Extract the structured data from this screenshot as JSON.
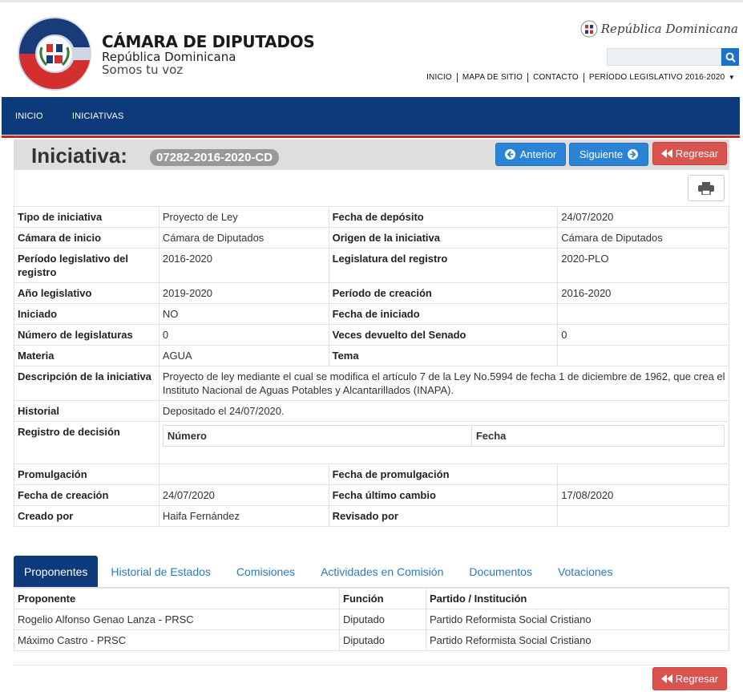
{
  "header": {
    "brand_title": "CÁMARA DE DIPUTADOS",
    "brand_sub": "República Dominicana",
    "brand_slogan": "Somos tu voz",
    "republica": "República Dominicana",
    "search_placeholder": "",
    "top_links": [
      "INICIO",
      "MAPA DE SITIO",
      "CONTACTO",
      "PERÍODO LEGISLATIVO 2016-2020"
    ]
  },
  "nav": {
    "items": [
      "INICIO",
      "INICIATIVAS"
    ]
  },
  "title": {
    "label": "Iniciativa:",
    "code": "07282-2016-2020-CD",
    "prev": "Anterior",
    "next": "Siguiente",
    "back": "Regresar"
  },
  "info": {
    "tipo_k": "Tipo de iniciativa",
    "tipo_v": "Proyecto de Ley",
    "fdep_k": "Fecha de depósito",
    "fdep_v": "24/07/2020",
    "cam_k": "Cámara de inicio",
    "cam_v": "Cámara de Diputados",
    "orig_k": "Origen de la iniciativa",
    "orig_v": "Cámara de Diputados",
    "per_k": "Período legislativo del registro",
    "per_v": "2016-2020",
    "legreg_k": "Legislatura del registro",
    "legreg_v": "2020-PLO",
    "anio_k": "Año legislativo",
    "anio_v": "2019-2020",
    "percre_k": "Período de creación",
    "percre_v": "2016-2020",
    "inic_k": "Iniciado",
    "inic_v": "NO",
    "finic_k": "Fecha de iniciado",
    "finic_v": "",
    "numleg_k": "Número de legislaturas",
    "numleg_v": "0",
    "veces_k": "Veces devuelto del Senado",
    "veces_v": "0",
    "mat_k": "Materia",
    "mat_v": "AGUA",
    "tema_k": "Tema",
    "tema_v": "",
    "desc_k": "Descripción de la iniciativa",
    "desc_v": "Proyecto de ley mediante el cual se modifica el artículo 7 de la Ley No.5994 de fecha 1 de diciembre de 1962, que crea el Instituto Nacional de Aguas Potables y Alcantarillados (INAPA).",
    "hist_k": "Historial",
    "hist_v": "Depositado el 24/07/2020.",
    "regdec_k": "Registro de decisión",
    "regdec_num": "Número",
    "regdec_fecha": "Fecha",
    "prom_k": "Promulgación",
    "prom_v": "",
    "fprom_k": "Fecha de promulgación",
    "fprom_v": "",
    "fcre_k": "Fecha de creación",
    "fcre_v": "24/07/2020",
    "fult_k": "Fecha último cambio",
    "fult_v": "17/08/2020",
    "creado_k": "Creado por",
    "creado_v": "Haifa Fernández",
    "rev_k": "Revisado por",
    "rev_v": ""
  },
  "tabs": [
    "Proponentes",
    "Historial de Estados",
    "Comisiones",
    "Actividades en Comisión",
    "Documentos",
    "Votaciones"
  ],
  "proponentes": {
    "headers": [
      "Proponente",
      "Función",
      "Partido / Institución"
    ],
    "rows": [
      [
        "Rogelio Alfonso Genao Lanza - PRSC",
        "Diputado",
        "Partido Reformista Social Cristiano"
      ],
      [
        "Máximo Castro - PRSC",
        "Diputado",
        "Partido Reformista Social Cristiano"
      ]
    ]
  },
  "footer": {
    "back": "Regresar"
  },
  "colors": {
    "nav": "#0d3a7a",
    "accent_red": "#c62828",
    "btn_blue": "#2b83d6",
    "btn_red": "#d9534f"
  }
}
